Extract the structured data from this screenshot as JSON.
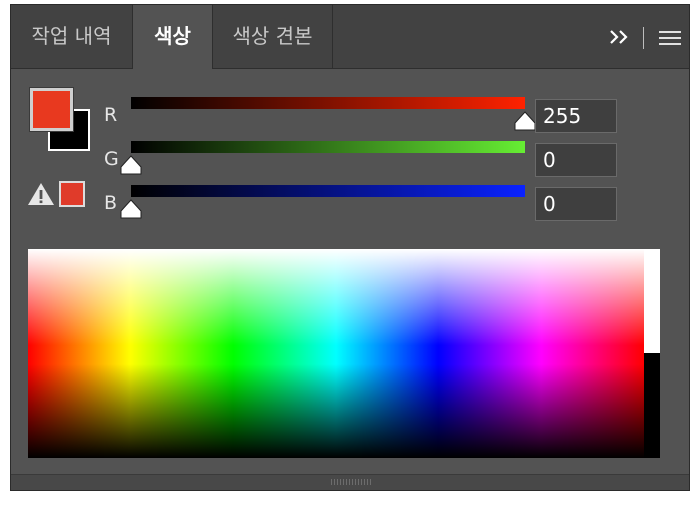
{
  "tabs": [
    {
      "label": "작업 내역",
      "active": false
    },
    {
      "label": "색상",
      "active": true
    },
    {
      "label": "색상 견본",
      "active": false
    }
  ],
  "tabbar": {
    "expand_icon": "double-chevron-right-icon",
    "menu_icon": "hamburger-menu-icon"
  },
  "swatches": {
    "foreground_color": "#e8391f",
    "background_color": "#000000",
    "gamut_warning_color": "#e03b2a"
  },
  "sliders": [
    {
      "label": "R",
      "value": "255",
      "level": 1.0
    },
    {
      "label": "G",
      "value": "0",
      "level": 0.0
    },
    {
      "label": "B",
      "value": "0",
      "level": 0.0
    }
  ],
  "colors": {
    "panel_bg": "#535353",
    "tabbar_bg": "#424242",
    "field_bg": "#3f3f3f"
  }
}
